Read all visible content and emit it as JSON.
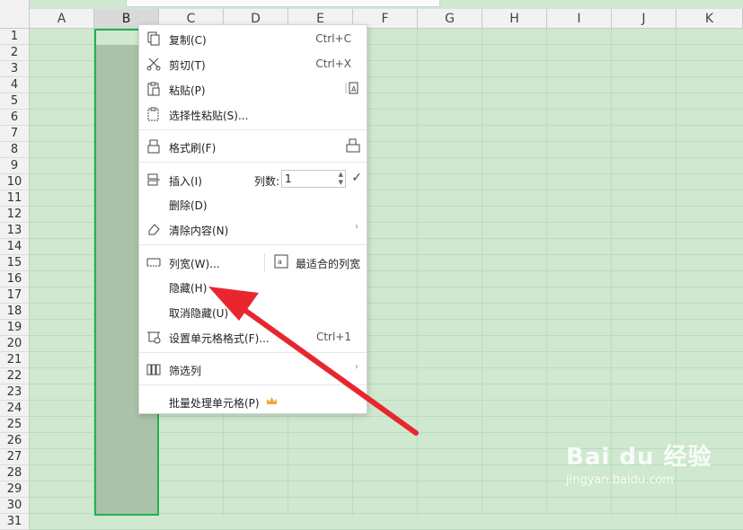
{
  "columns": [
    "A",
    "B",
    "C",
    "D",
    "E",
    "F",
    "G",
    "H",
    "I",
    "J",
    "K"
  ],
  "selected_column": "B",
  "rows": [
    "1",
    "2",
    "3",
    "4",
    "5",
    "6",
    "7",
    "8",
    "9",
    "10",
    "11",
    "12",
    "13",
    "14",
    "15",
    "16",
    "17",
    "18",
    "19",
    "20",
    "21",
    "22",
    "23",
    "24",
    "25",
    "26",
    "27",
    "28",
    "29",
    "30",
    "31"
  ],
  "context_menu": {
    "copy": {
      "label": "复制(C)",
      "shortcut": "Ctrl+C",
      "icon": "copy-icon"
    },
    "cut": {
      "label": "剪切(T)",
      "shortcut": "Ctrl+X",
      "icon": "scissors-icon"
    },
    "paste": {
      "label": "粘贴(P)",
      "icon": "paste-icon"
    },
    "paste_special": {
      "label": "选择性粘贴(S)...",
      "icon": "paste-special-icon"
    },
    "format_painter": {
      "label": "格式刷(F)",
      "icon": "brush-icon"
    },
    "insert": {
      "label": "插入(I)",
      "count_label": "列数:",
      "count_value": "1",
      "icon": "insert-icon"
    },
    "delete": {
      "label": "删除(D)"
    },
    "clear": {
      "label": "清除内容(N)",
      "icon": "eraser-icon"
    },
    "col_width": {
      "label": "列宽(W)...",
      "icon": "column-width-icon"
    },
    "best_fit": {
      "label": "最适合的列宽",
      "icon": "best-fit-icon"
    },
    "hide": {
      "label": "隐藏(H)"
    },
    "unhide": {
      "label": "取消隐藏(U)"
    },
    "format_cells": {
      "label": "设置单元格格式(F)...",
      "shortcut": "Ctrl+1",
      "icon": "format-cells-icon"
    },
    "filter": {
      "label": "筛选列",
      "icon": "filter-column-icon"
    },
    "batch": {
      "label": "批量处理单元格(P)",
      "icon": "crown-icon"
    }
  },
  "colors": {
    "sheet_bg": "#cfe8cf",
    "selection_border": "#22b14c",
    "arrow": "#e8262e"
  },
  "watermark": {
    "brand": "Bai du 经验",
    "url": "jingyan.baidu.com"
  }
}
